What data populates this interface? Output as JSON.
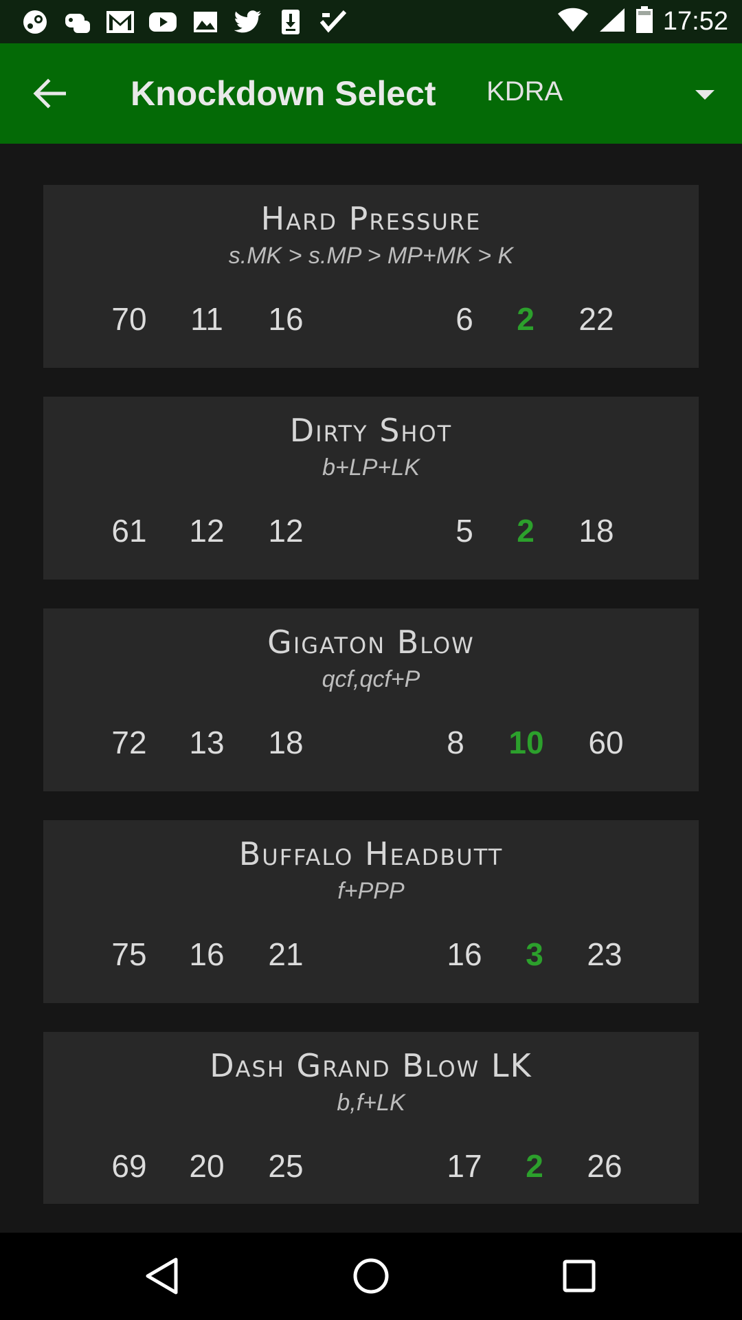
{
  "status_bar": {
    "time": "17:52",
    "notification_icons": [
      "steam-icon",
      "game-controller-icon",
      "gmail-icon",
      "youtube-icon",
      "image-icon",
      "twitter-icon",
      "download-icon",
      "checklist-icon"
    ],
    "system_icons": [
      "wifi-icon",
      "signal-icon",
      "battery-icon"
    ]
  },
  "app_bar": {
    "title": "Knockdown Select",
    "spinner_value": "KDRA"
  },
  "colors": {
    "app_bar": "#046a06",
    "status_bar": "#0e2410",
    "background": "#161616",
    "card": "#282828",
    "highlight": "#2ca02c"
  },
  "moves": [
    {
      "name": "Hard Pressure",
      "input": "s.MK > s.MP > MP+MK > K",
      "stats": [
        "70",
        "11",
        "16",
        "6",
        "2",
        "22"
      ]
    },
    {
      "name": "Dirty Shot",
      "input": "b+LP+LK",
      "stats": [
        "61",
        "12",
        "12",
        "5",
        "2",
        "18"
      ]
    },
    {
      "name": "Gigaton Blow",
      "input": "qcf,qcf+P",
      "stats": [
        "72",
        "13",
        "18",
        "8",
        "10",
        "60"
      ]
    },
    {
      "name": "Buffalo Headbutt",
      "input": "f+PPP",
      "stats": [
        "75",
        "16",
        "21",
        "16",
        "3",
        "23"
      ]
    },
    {
      "name": "Dash Grand Blow LK",
      "input": "b,f+LK",
      "stats": [
        "69",
        "20",
        "25",
        "17",
        "2",
        "26"
      ]
    }
  ],
  "nav_bar": {
    "icons": [
      "back-triangle-icon",
      "home-circle-icon",
      "recents-square-icon"
    ]
  }
}
